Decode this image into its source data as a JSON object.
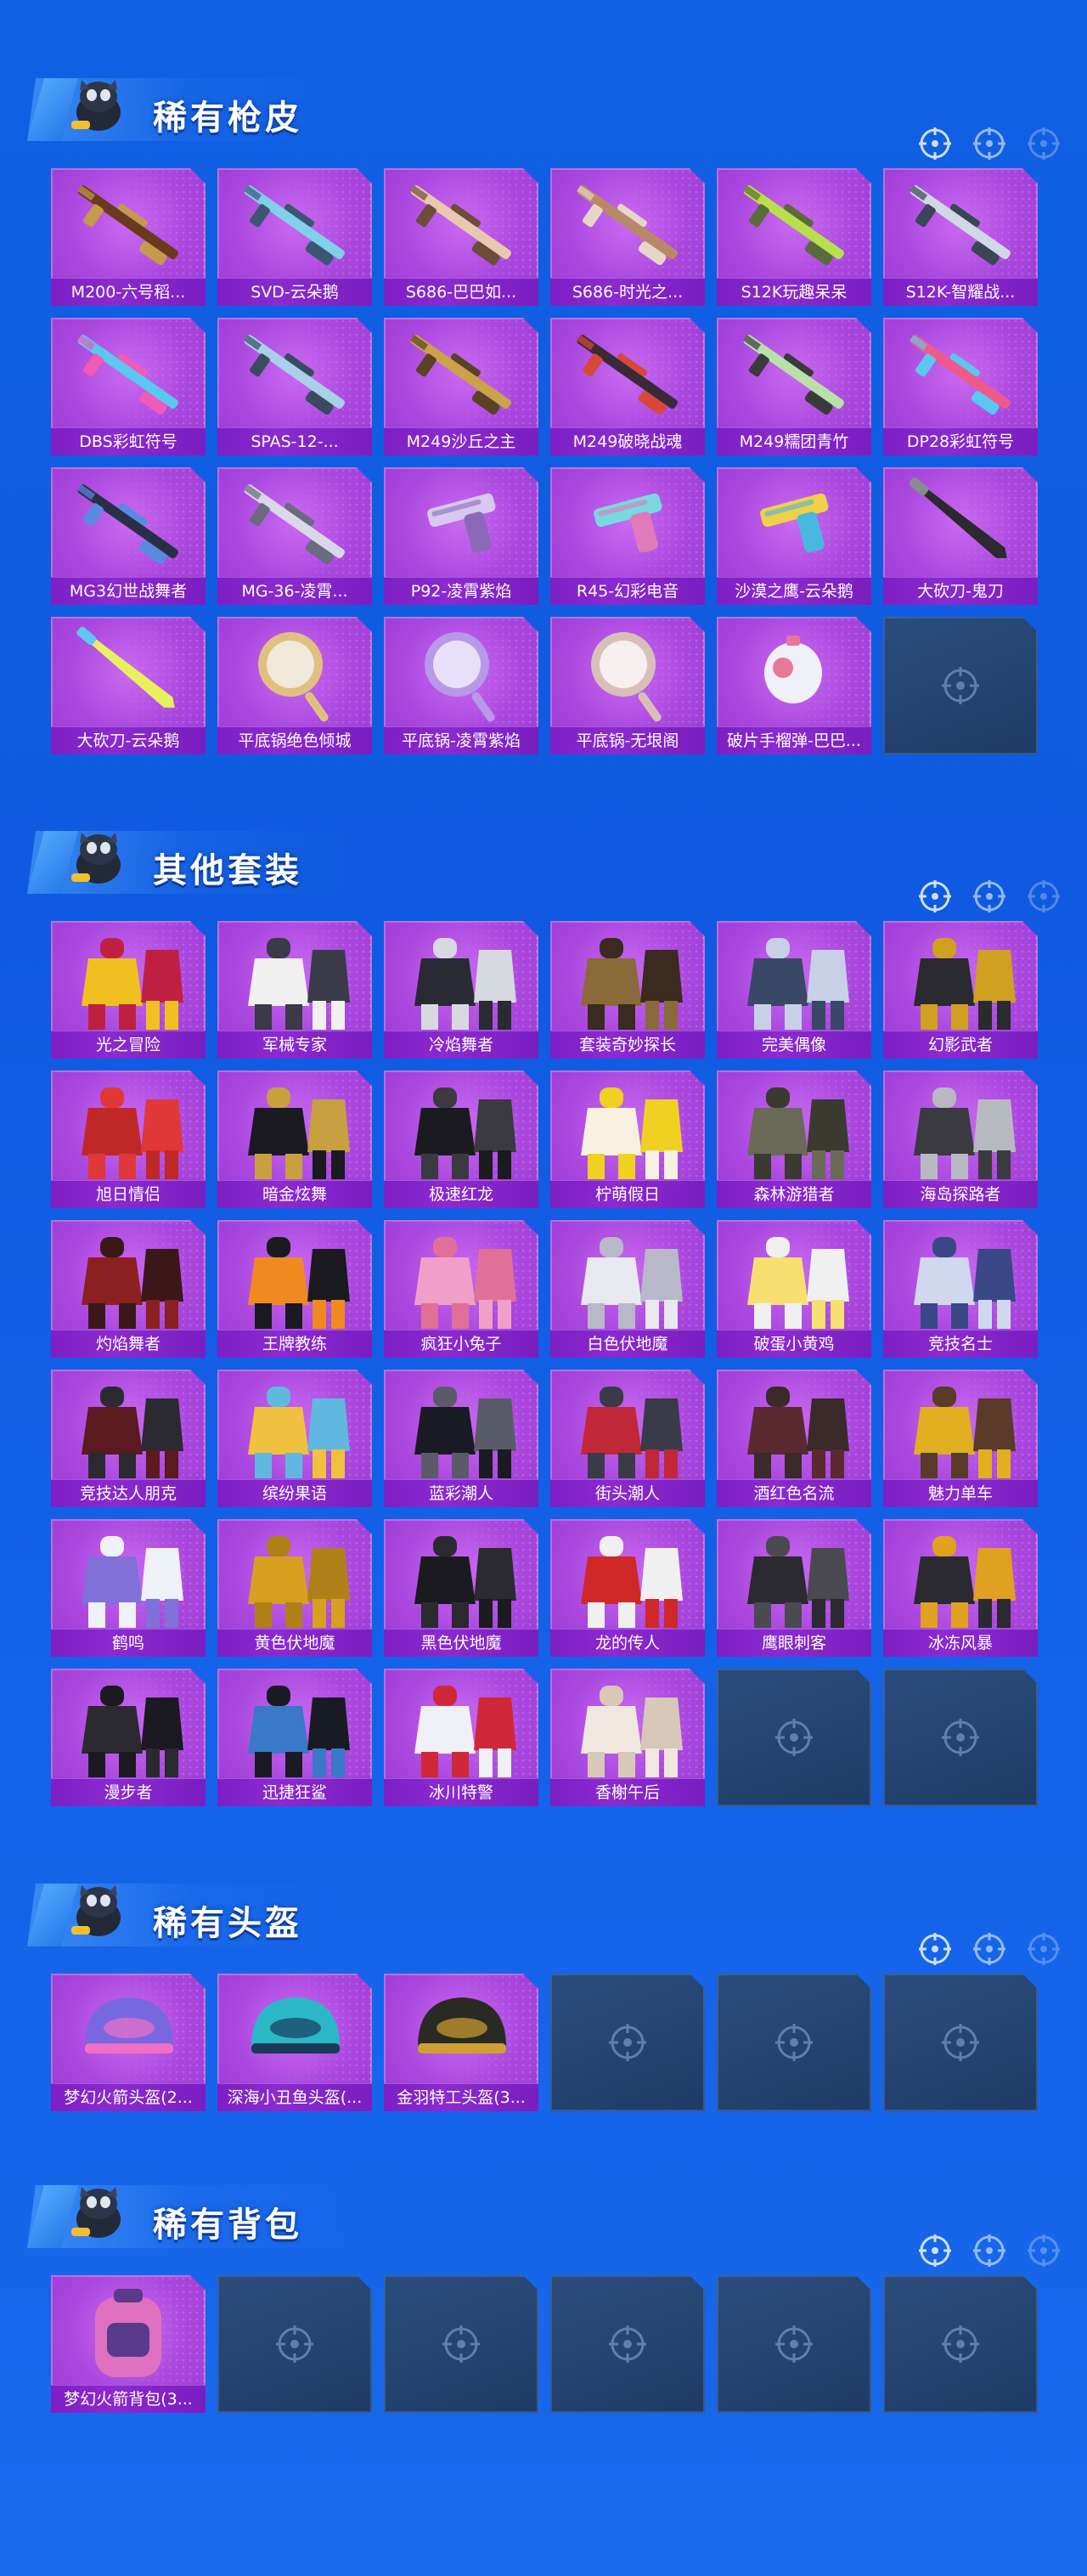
{
  "sections": {
    "skins": {
      "title": "稀有枪皮",
      "items": [
        {
          "label": "M200-六号稻...",
          "kind": "sniper",
          "c1": "#6b3a1e",
          "c2": "#c59a4a"
        },
        {
          "label": "SVD-云朵鹅",
          "kind": "sniper",
          "c1": "#7fd0e8",
          "c2": "#3a5670"
        },
        {
          "label": "S686-巴巴如...",
          "kind": "shotgun",
          "c1": "#e9c8b0",
          "c2": "#6d4c3a"
        },
        {
          "label": "S686-时光之...",
          "kind": "shotgun",
          "c1": "#b88968",
          "c2": "#e5d6c8"
        },
        {
          "label": "S12K玩趣呆呆",
          "kind": "rifle",
          "c1": "#b7e04a",
          "c2": "#5a6b3c"
        },
        {
          "label": "S12K-智耀战...",
          "kind": "rifle",
          "c1": "#cfd8e4",
          "c2": "#3a4656"
        },
        {
          "label": "DBS彩虹符号",
          "kind": "smg",
          "c1": "#5ac8f0",
          "c2": "#f05ab8"
        },
        {
          "label": "SPAS-12-...",
          "kind": "shotgun",
          "c1": "#a8d0e8",
          "c2": "#3c4a60"
        },
        {
          "label": "M249沙丘之主",
          "kind": "lmg",
          "c1": "#c9a24a",
          "c2": "#5a4226"
        },
        {
          "label": "M249破晓战魂",
          "kind": "lmg",
          "c1": "#3a2a38",
          "c2": "#d8483a"
        },
        {
          "label": "M249糯团青竹",
          "kind": "lmg",
          "c1": "#b8e0a8",
          "c2": "#3a3a3a"
        },
        {
          "label": "DP28彩虹符号",
          "kind": "lmg",
          "c1": "#f05a8a",
          "c2": "#5ac8f0"
        },
        {
          "label": "MG3幻世战舞者",
          "kind": "lmg",
          "c1": "#2a2f48",
          "c2": "#5a8ae0"
        },
        {
          "label": "MG-36-凌霄...",
          "kind": "rifle",
          "c1": "#d8d8e8",
          "c2": "#6a6a80"
        },
        {
          "label": "P92-凌霄紫焰",
          "kind": "pistol",
          "c1": "#d8c8f0",
          "c2": "#8a6ab8"
        },
        {
          "label": "R45-幻彩电音",
          "kind": "pistol",
          "c1": "#7ad8e0",
          "c2": "#e07ab8"
        },
        {
          "label": "沙漠之鹰-云朵鹅",
          "kind": "pistol",
          "c1": "#f0d048",
          "c2": "#48b8e0"
        },
        {
          "label": "大砍刀-鬼刀",
          "kind": "blade",
          "c1": "#2a2a30",
          "c2": "#8a8a90"
        },
        {
          "label": "大砍刀-云朵鹅",
          "kind": "blade",
          "c1": "#e8f060",
          "c2": "#60c8f0"
        },
        {
          "label": "平底锅绝色倾城",
          "kind": "pan",
          "c1": "#e0c080",
          "c2": "#f0e8d8"
        },
        {
          "label": "平底锅-凌霄紫焰",
          "kind": "pan",
          "c1": "#b898e8",
          "c2": "#e8e0f8"
        },
        {
          "label": "平底锅-无垠阁",
          "kind": "pan",
          "c1": "#d8c0b8",
          "c2": "#f8f0f0"
        },
        {
          "label": "破片手榴弹-巴巴...",
          "kind": "grenade",
          "c1": "#f0f0f8",
          "c2": "#e87898"
        },
        {
          "label": "",
          "kind": "empty"
        }
      ]
    },
    "outfits": {
      "title": "其他套装",
      "items": [
        {
          "label": "光之冒险",
          "kind": "outfit",
          "c1": "#f0c020",
          "c2": "#c02040"
        },
        {
          "label": "军械专家",
          "kind": "outfit",
          "c1": "#f0f0f0",
          "c2": "#3a3a48"
        },
        {
          "label": "冷焰舞者",
          "kind": "outfit",
          "c1": "#2a2a34",
          "c2": "#d8d8e0"
        },
        {
          "label": "套装奇妙探长",
          "kind": "outfit",
          "c1": "#8a6a3a",
          "c2": "#3a2a20"
        },
        {
          "label": "完美偶像",
          "kind": "outfit",
          "c1": "#3a4868",
          "c2": "#c8d0e8"
        },
        {
          "label": "幻影武者",
          "kind": "outfit",
          "c1": "#2a2a30",
          "c2": "#d0a020"
        },
        {
          "label": "旭日情侣",
          "kind": "outfit",
          "c1": "#c02828",
          "c2": "#e03838"
        },
        {
          "label": "暗金炫舞",
          "kind": "outfit",
          "c1": "#1a1a20",
          "c2": "#c8a040"
        },
        {
          "label": "极速红龙",
          "kind": "outfit",
          "c1": "#1a1a20",
          "c2": "#3a3a40"
        },
        {
          "label": "柠萌假日",
          "kind": "outfit",
          "c1": "#f8f0e0",
          "c2": "#f0d020"
        },
        {
          "label": "森林游猎者",
          "kind": "outfit",
          "c1": "#6a6a58",
          "c2": "#3a3a30"
        },
        {
          "label": "海岛探路者",
          "kind": "outfit",
          "c1": "#3a3a40",
          "c2": "#b8b8c0"
        },
        {
          "label": "灼焰舞者",
          "kind": "outfit",
          "c1": "#8a2020",
          "c2": "#3a1818"
        },
        {
          "label": "王牌教练",
          "kind": "outfit",
          "c1": "#f08a20",
          "c2": "#1a1a20"
        },
        {
          "label": "疯狂小兔子",
          "kind": "outfit",
          "c1": "#f0a0c8",
          "c2": "#e07098"
        },
        {
          "label": "白色伏地魔",
          "kind": "outfit",
          "c1": "#e8e8f0",
          "c2": "#b8b8c8"
        },
        {
          "label": "破蛋小黄鸡",
          "kind": "outfit",
          "c1": "#f8e070",
          "c2": "#f0f0f0"
        },
        {
          "label": "竞技名士",
          "kind": "outfit",
          "c1": "#d0d8f0",
          "c2": "#3a4888"
        },
        {
          "label": "竞技达人朋克",
          "kind": "outfit",
          "c1": "#5a1a20",
          "c2": "#2a2a30"
        },
        {
          "label": "缤纷果语",
          "kind": "outfit",
          "c1": "#f0c040",
          "c2": "#60b8e0"
        },
        {
          "label": "蓝彩潮人",
          "kind": "outfit",
          "c1": "#1a1a24",
          "c2": "#5a5a68"
        },
        {
          "label": "街头潮人",
          "kind": "outfit",
          "c1": "#c02838",
          "c2": "#3a3a48"
        },
        {
          "label": "酒红色名流",
          "kind": "outfit",
          "c1": "#5a2a30",
          "c2": "#3a2a2a"
        },
        {
          "label": "魅力单车",
          "kind": "outfit",
          "c1": "#e0b020",
          "c2": "#5a3a28"
        },
        {
          "label": "鹤鸣",
          "kind": "outfit",
          "c1": "#8070d8",
          "c2": "#f0f0f8"
        },
        {
          "label": "黄色伏地魔",
          "kind": "outfit",
          "c1": "#d8a020",
          "c2": "#b08018"
        },
        {
          "label": "黑色伏地魔",
          "kind": "outfit",
          "c1": "#1a1a20",
          "c2": "#2a2a30"
        },
        {
          "label": "龙的传人",
          "kind": "outfit",
          "c1": "#d02828",
          "c2": "#f0f0f0"
        },
        {
          "label": "鹰眼刺客",
          "kind": "outfit",
          "c1": "#2a2a30",
          "c2": "#4a4a50"
        },
        {
          "label": "冰冻风暴",
          "kind": "outfit",
          "c1": "#2a2a30",
          "c2": "#e0a020"
        },
        {
          "label": "漫步者",
          "kind": "outfit",
          "c1": "#2a2a30",
          "c2": "#1a1a20"
        },
        {
          "label": "迅捷狂鲨",
          "kind": "outfit",
          "c1": "#3a78c8",
          "c2": "#1a1a24"
        },
        {
          "label": "冰川特警",
          "kind": "outfit",
          "c1": "#f0f0f8",
          "c2": "#d02838"
        },
        {
          "label": "香榭午后",
          "kind": "outfit",
          "c1": "#f0e8e0",
          "c2": "#d8c8b8"
        },
        {
          "label": "",
          "kind": "empty"
        },
        {
          "label": "",
          "kind": "empty"
        }
      ]
    },
    "helmets": {
      "title": "稀有头盔",
      "items": [
        {
          "label": "梦幻火箭头盔(2...",
          "kind": "helmet",
          "c1": "#7868e0",
          "c2": "#f070c8"
        },
        {
          "label": "深海小丑鱼头盔(...",
          "kind": "helmet",
          "c1": "#2ab8c8",
          "c2": "#1a3a5a"
        },
        {
          "label": "金羽特工头盔(3...",
          "kind": "helmet",
          "c1": "#2a2a24",
          "c2": "#d0a030"
        },
        {
          "label": "",
          "kind": "empty"
        },
        {
          "label": "",
          "kind": "empty"
        },
        {
          "label": "",
          "kind": "empty"
        }
      ]
    },
    "backpacks": {
      "title": "稀有背包",
      "items": [
        {
          "label": "梦幻火箭背包(3...",
          "kind": "backpack",
          "c1": "#e070c0",
          "c2": "#5a3a8a"
        },
        {
          "label": "",
          "kind": "empty"
        },
        {
          "label": "",
          "kind": "empty"
        },
        {
          "label": "",
          "kind": "empty"
        },
        {
          "label": "",
          "kind": "empty"
        },
        {
          "label": "",
          "kind": "empty"
        }
      ]
    }
  }
}
